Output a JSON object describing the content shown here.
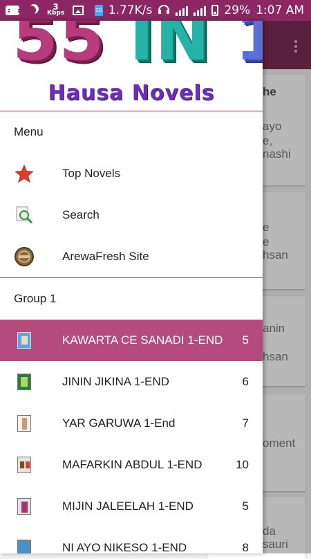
{
  "status_bar": {
    "kbps_num": "3",
    "kbps_unit": "Kbps",
    "sd_text": "SD",
    "speed": "1.77K/s",
    "battery": "29%",
    "time": "1:07 AM"
  },
  "drawer": {
    "logo": {
      "title_p1": "55",
      "title_p2": "IN",
      "title_p3": "1",
      "subtitle": "Hausa Novels"
    },
    "menu_header": "Menu",
    "menu_items": [
      {
        "label": "Top Novels",
        "icon": "star-icon"
      },
      {
        "label": "Search",
        "icon": "search-icon"
      },
      {
        "label": "ArewaFresh Site",
        "icon": "site-logo-icon"
      }
    ],
    "group_header": "Group 1",
    "novels": [
      {
        "label": "KAWARTA CE SANADI 1-END",
        "count": "5",
        "active": true
      },
      {
        "label": "JININ JIKINA 1-END",
        "count": "6"
      },
      {
        "label": "YAR GARUWA 1-End",
        "count": "7"
      },
      {
        "label": "MAFARKIN ABDUL 1-END",
        "count": "10"
      },
      {
        "label": "MIJIN JALEELAH 1-END",
        "count": "5"
      },
      {
        "label": "NI AYO NIKESO 1-END",
        "count": "8"
      }
    ]
  },
  "background": {
    "fragments": [
      "he",
      "ayo",
      "e,",
      "nashi",
      "e",
      "e",
      "hsan",
      "anin",
      "hsan",
      "oment",
      "da",
      "sauri"
    ]
  },
  "colors": {
    "status_bar": "#8c2763",
    "app_bar": "#7d2a56",
    "active_item": "#b54a7e",
    "divider": "#9b3a6b"
  }
}
